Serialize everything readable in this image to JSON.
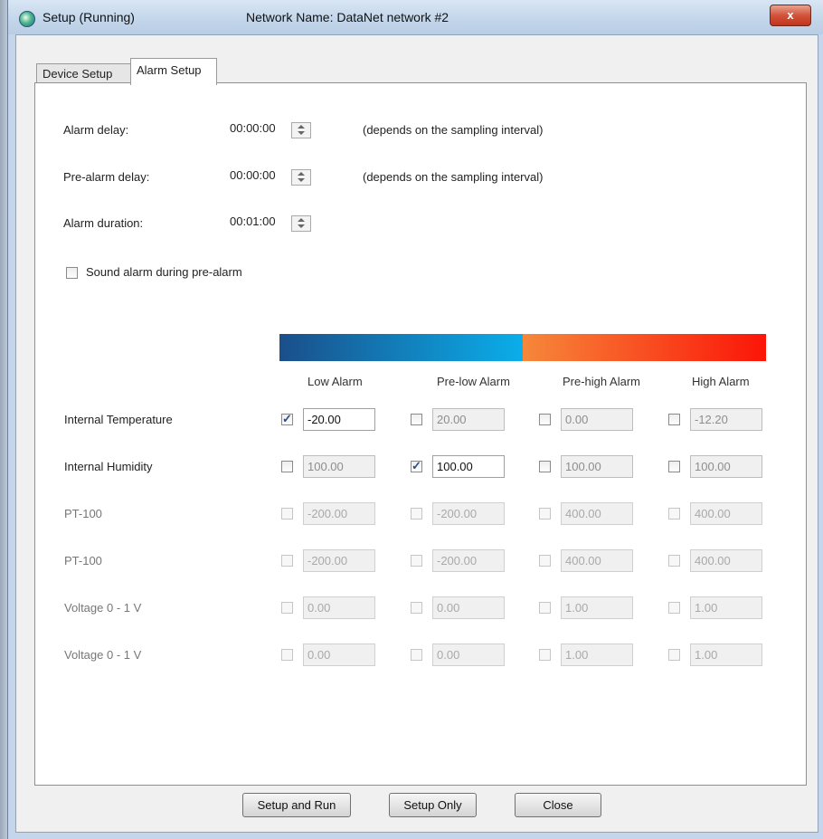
{
  "window": {
    "title": "Setup (Running)",
    "network_label": "Network Name: DataNet network #2",
    "close_glyph": "x"
  },
  "tabs": [
    {
      "label": "Device Setup",
      "active": false
    },
    {
      "label": "Alarm Setup",
      "active": true
    }
  ],
  "delays": {
    "alarm_delay": {
      "label": "Alarm delay:",
      "value": "00:00:00",
      "note": "(depends on the sampling interval)"
    },
    "pre_alarm_delay": {
      "label": "Pre-alarm delay:",
      "value": "00:00:00",
      "note": "(depends on the sampling interval)"
    },
    "alarm_duration": {
      "label": "Alarm duration:",
      "value": "00:01:00"
    }
  },
  "sound_alarm": {
    "label": "Sound alarm during pre-alarm",
    "checked": false
  },
  "gradient": {
    "low_start": "#1a4f8a",
    "low_end": "#0aaeea",
    "high_start": "#f6883a",
    "high_end": "#fb1508"
  },
  "columns": [
    "Low Alarm",
    "Pre-low Alarm",
    "Pre-high Alarm",
    "High Alarm"
  ],
  "rows": [
    {
      "label": "Internal Temperature",
      "enabled": true,
      "cells": [
        {
          "checked": true,
          "value": "-20.00"
        },
        {
          "checked": false,
          "value": "20.00"
        },
        {
          "checked": false,
          "value": "0.00"
        },
        {
          "checked": false,
          "value": "-12.20"
        }
      ]
    },
    {
      "label": "Internal Humidity",
      "enabled": true,
      "cells": [
        {
          "checked": false,
          "value": "100.00"
        },
        {
          "checked": true,
          "value": "100.00"
        },
        {
          "checked": false,
          "value": "100.00"
        },
        {
          "checked": false,
          "value": "100.00"
        }
      ]
    },
    {
      "label": "PT-100",
      "enabled": false,
      "cells": [
        {
          "checked": false,
          "value": "-200.00"
        },
        {
          "checked": false,
          "value": "-200.00"
        },
        {
          "checked": false,
          "value": "400.00"
        },
        {
          "checked": false,
          "value": "400.00"
        }
      ]
    },
    {
      "label": "PT-100",
      "enabled": false,
      "cells": [
        {
          "checked": false,
          "value": "-200.00"
        },
        {
          "checked": false,
          "value": "-200.00"
        },
        {
          "checked": false,
          "value": "400.00"
        },
        {
          "checked": false,
          "value": "400.00"
        }
      ]
    },
    {
      "label": "Voltage 0 - 1 V",
      "enabled": false,
      "cells": [
        {
          "checked": false,
          "value": "0.00"
        },
        {
          "checked": false,
          "value": "0.00"
        },
        {
          "checked": false,
          "value": "1.00"
        },
        {
          "checked": false,
          "value": "1.00"
        }
      ]
    },
    {
      "label": "Voltage 0 - 1 V",
      "enabled": false,
      "cells": [
        {
          "checked": false,
          "value": "0.00"
        },
        {
          "checked": false,
          "value": "0.00"
        },
        {
          "checked": false,
          "value": "1.00"
        },
        {
          "checked": false,
          "value": "1.00"
        }
      ]
    }
  ],
  "buttons": {
    "setup_and_run": "Setup and Run",
    "setup_only": "Setup Only",
    "close": "Close"
  }
}
